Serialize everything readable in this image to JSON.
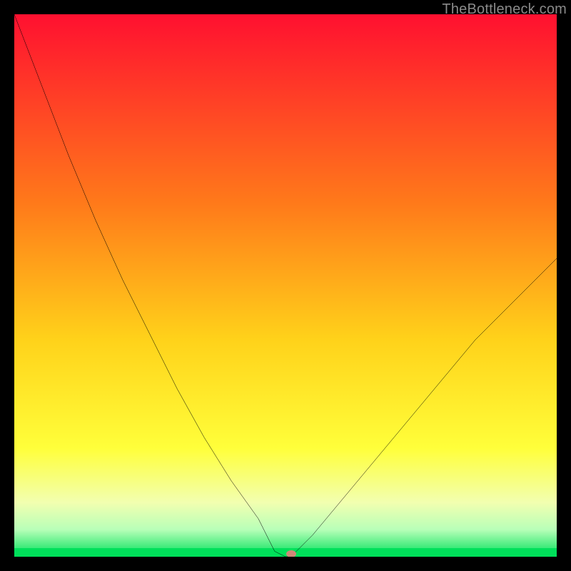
{
  "watermark": {
    "text": "TheBottleneck.com"
  },
  "colors": {
    "frame": "#000000",
    "watermark": "#8a8a8a",
    "curve": "#000000",
    "marker": "#d08878",
    "gradient_stops": [
      {
        "pct": 0,
        "color": "#ff1030"
      },
      {
        "pct": 35,
        "color": "#ff7a1a"
      },
      {
        "pct": 60,
        "color": "#ffd21a"
      },
      {
        "pct": 80,
        "color": "#ffff3a"
      },
      {
        "pct": 90,
        "color": "#f2ffb0"
      },
      {
        "pct": 95,
        "color": "#b8ffb8"
      },
      {
        "pct": 100,
        "color": "#00e05a"
      }
    ]
  },
  "chart_data": {
    "type": "line",
    "title": "",
    "xlabel": "",
    "ylabel": "",
    "xlim": [
      0,
      100
    ],
    "ylim": [
      100,
      0
    ],
    "grid": false,
    "legend": false,
    "notes": "Bottleneck-style V-curve over a vertical red→green gradient. Minimum touches the green band. No visible axis ticks or labels.",
    "series": [
      {
        "name": "bottleneck-curve",
        "x": [
          0,
          5,
          10,
          15,
          20,
          25,
          30,
          35,
          40,
          45,
          47,
          48,
          50,
          51,
          52,
          55,
          60,
          65,
          70,
          75,
          80,
          85,
          90,
          95,
          100
        ],
        "y": [
          0,
          13,
          26,
          38,
          49,
          59,
          69,
          78,
          86,
          93,
          97,
          99,
          100,
          100,
          99,
          96,
          90,
          84,
          78,
          72,
          66,
          60,
          55,
          50,
          45
        ]
      }
    ],
    "marker": {
      "x": 51,
      "y": 100,
      "color": "#d08878"
    }
  }
}
